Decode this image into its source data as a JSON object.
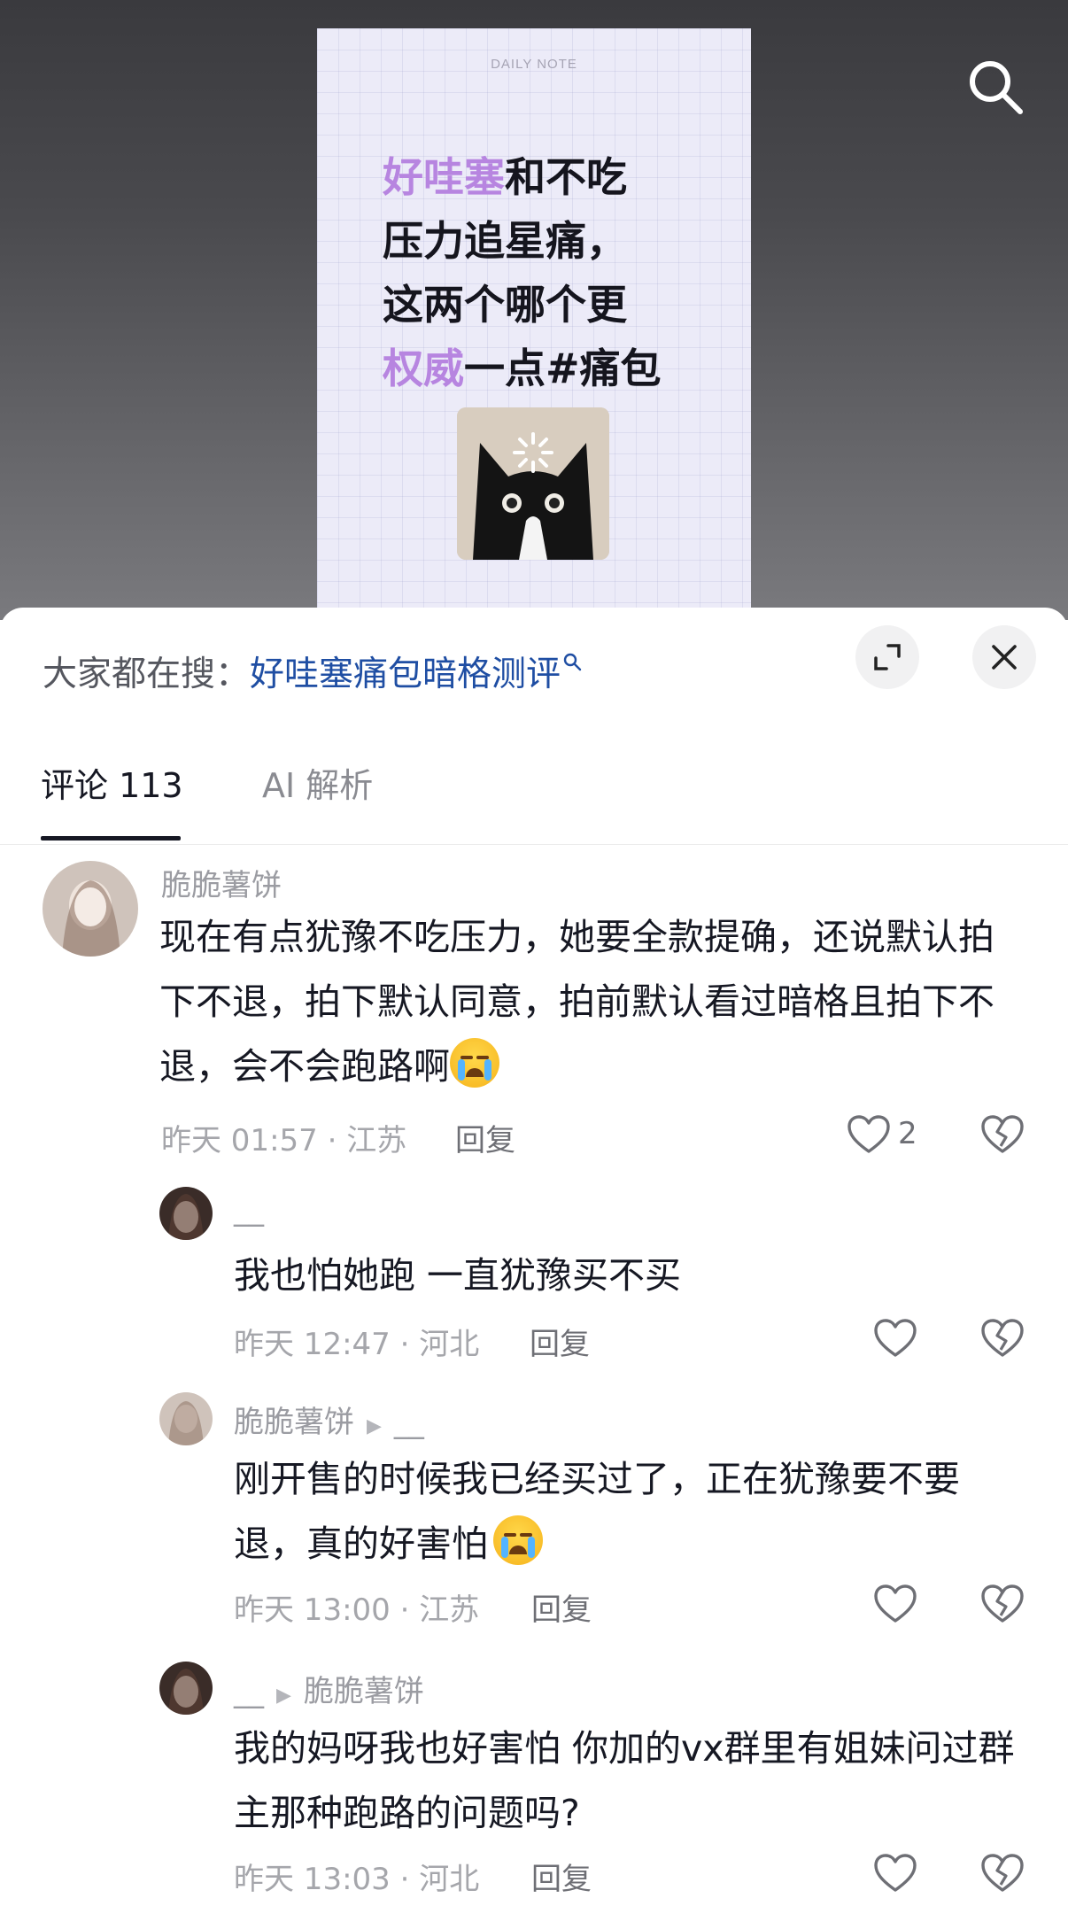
{
  "video": {
    "note_label": "DAILY NOTE",
    "lines": [
      {
        "hl": "好哇塞",
        "rest": "和不吃"
      },
      {
        "hl": "",
        "rest": "压力追星痛，"
      },
      {
        "hl": "",
        "rest": "这两个哪个更"
      },
      {
        "hl": "权威",
        "rest": "一点#痛包"
      }
    ]
  },
  "trending": {
    "prefix": "大家都在搜：",
    "keyword": "好哇塞痛包暗格测评"
  },
  "tabs": {
    "comments": "评论 113",
    "ai": "AI 解析"
  },
  "comments": [
    {
      "user": "脆脆薯饼",
      "text": "现在有点犹豫不吃压力，她要全款提确，还说默认拍下不退，拍下默认同意，拍前默认看过暗格且拍下不退，会不会跑路啊",
      "meta": "昨天 01:57 · 江苏",
      "reply": "回复",
      "likes": "2"
    },
    {
      "user": "__",
      "reply_to": "",
      "text": "我也怕她跑 一直犹豫买不买",
      "meta": "昨天 12:47 · 河北",
      "reply": "回复"
    },
    {
      "user": "脆脆薯饼",
      "reply_to": "__",
      "text": "刚开售的时候我已经买过了，正在犹豫要不要退，真的好害怕",
      "meta": "昨天 13:00 · 江苏",
      "reply": "回复"
    },
    {
      "user": "__",
      "reply_to": "脆脆薯饼",
      "text": "我的妈呀我也好害怕 你加的vx群里有姐妹问过群主那种跑路的问题吗?",
      "meta": "昨天 13:03 · 河北",
      "reply": "回复"
    }
  ]
}
